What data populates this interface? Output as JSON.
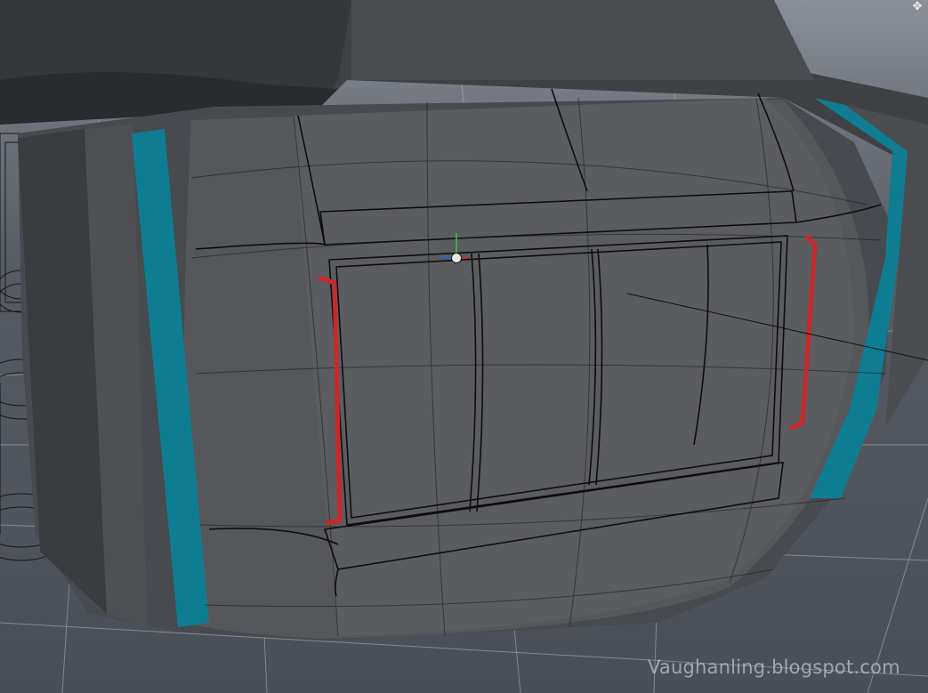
{
  "viewport": {
    "watermark_text": "Vaughanling.blogspot.com",
    "navigation_icon": "move-arrows-icon",
    "colors": {
      "background": "#4b5058",
      "hull_dark": "#3a3c40",
      "hull_mid": "#4b4d51",
      "hull_light": "#5d5f63",
      "accent_band": "#0f7d91",
      "edge_highlight": "#c8282a",
      "grid": "#b9bcc2",
      "wire": "#0d0d0d",
      "manipulator_green": "#29d13a"
    }
  }
}
